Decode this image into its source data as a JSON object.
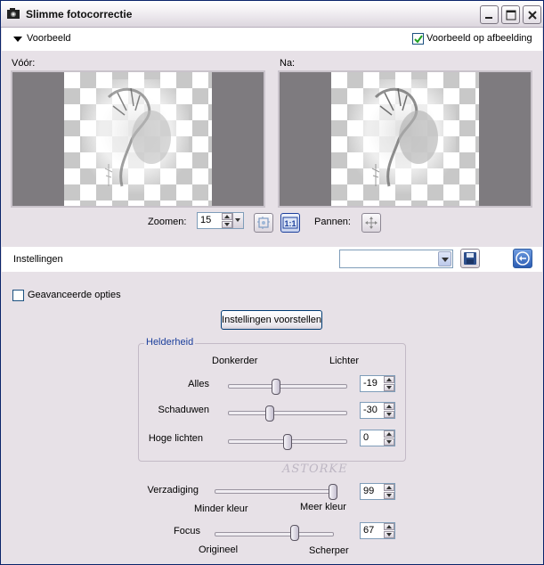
{
  "window": {
    "title": "Slimme fotocorrectie"
  },
  "preview_bar": {
    "label": "Voorbeeld",
    "on_image_label": "Voorbeeld op afbeelding",
    "on_image_checked": true
  },
  "previews": {
    "before_label": "Vóór:",
    "after_label": "Na:"
  },
  "zoom": {
    "label": "Zoomen:",
    "value": "15",
    "pan_label": "Pannen:"
  },
  "settings": {
    "label": "Instellingen",
    "preset_value": ""
  },
  "advanced": {
    "label": "Geavanceerde opties",
    "checked": false
  },
  "suggest_button": "Instellingen voorstellen",
  "brightness": {
    "group_title": "Helderheid",
    "darker_label": "Donkerder",
    "lighter_label": "Lichter",
    "sliders": [
      {
        "label": "Alles",
        "value": "-19",
        "level": -19
      },
      {
        "label": "Schaduwen",
        "value": "-30",
        "level": -30
      },
      {
        "label": "Hoge lichten",
        "value": "0",
        "level": 0
      }
    ]
  },
  "saturation": {
    "label": "Verzadiging",
    "value": "99",
    "level": 99,
    "min_label": "Minder kleur",
    "max_label": "Meer kleur"
  },
  "focus": {
    "label": "Focus",
    "value": "67",
    "level": 67,
    "min_label": "Origineel",
    "max_label": "Scherper"
  },
  "watermark": "ASTORKE",
  "colors": {
    "window_bg": "#e7e1e7",
    "accent_blue": "#1c3f9c",
    "preview_gray": "#7e7b7f"
  }
}
